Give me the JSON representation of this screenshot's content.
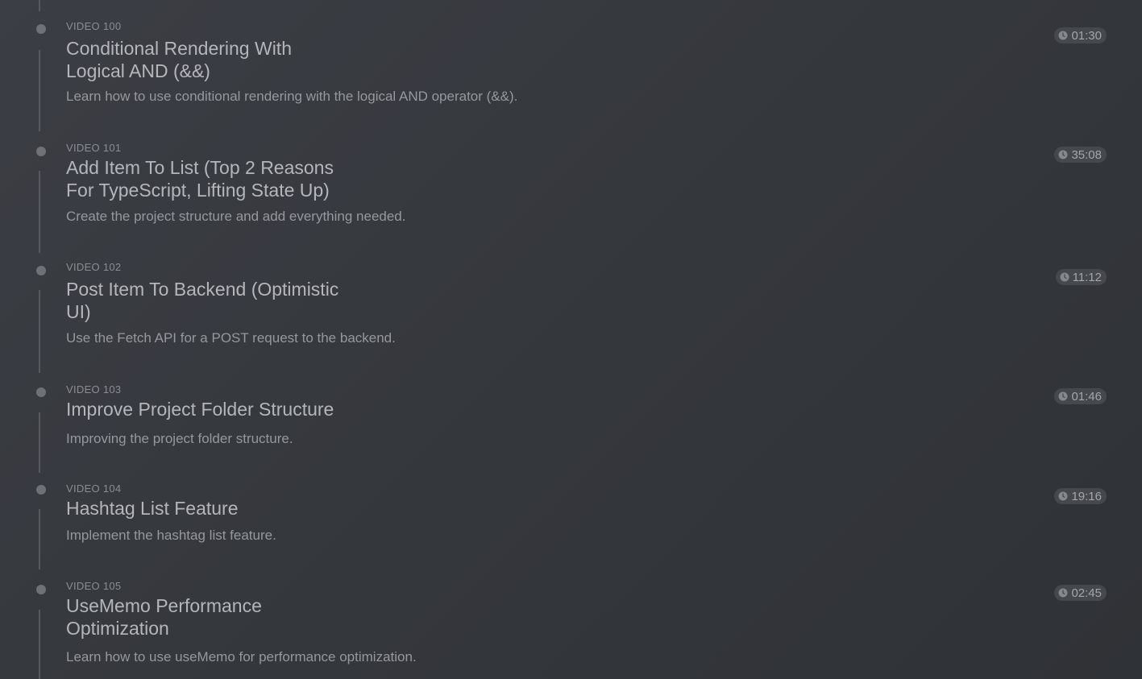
{
  "videos": [
    {
      "number_label": "VIDEO 100",
      "title_line1": "Conditional Rendering With",
      "title_line2": "Logical AND (&&)",
      "description": "Learn how to use conditional rendering with the logical AND operator (&&).",
      "duration": "01:30"
    },
    {
      "number_label": "VIDEO 101",
      "title_line1": "Add Item To List (Top 2 Reasons",
      "title_line2": "For TypeScript, Lifting State Up)",
      "description": "Create the project structure and add everything needed.",
      "duration": "35:08"
    },
    {
      "number_label": "VIDEO 102",
      "title_line1": "Post Item To Backend (Optimistic",
      "title_line2": "UI)",
      "description": "Use the Fetch API for a POST request to the backend.",
      "duration": "11:12"
    },
    {
      "number_label": "VIDEO 103",
      "title_line1": "Improve Project Folder Structure",
      "title_line2": "",
      "description": "Improving the project folder structure.",
      "duration": "01:46"
    },
    {
      "number_label": "VIDEO 104",
      "title_line1": "Hashtag List Feature",
      "title_line2": "",
      "description": "Implement the hashtag list feature.",
      "duration": "19:16"
    },
    {
      "number_label": "VIDEO 105",
      "title_line1": "UseMemo Performance",
      "title_line2": "Optimization",
      "description": "Learn how to use useMemo for performance optimization.",
      "duration": "02:45"
    }
  ],
  "icons": {
    "timeline_dot": "circle",
    "duration": "clock-icon"
  }
}
